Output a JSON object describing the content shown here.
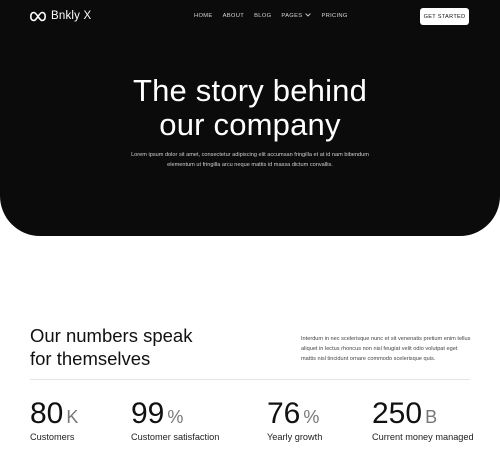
{
  "brand": {
    "name": "Bnkly X"
  },
  "nav": {
    "items": [
      {
        "label": "HOME"
      },
      {
        "label": "ABOUT"
      },
      {
        "label": "BLOG"
      },
      {
        "label": "PAGES"
      },
      {
        "label": "PRICING"
      }
    ],
    "cta_label": "GET STARTED"
  },
  "hero": {
    "title_line1": "The story behind",
    "title_line2": "our company",
    "subtitle": "Lorem ipsum dolor sit amet, consectetur adipiscing elit accumsan fringilla et at id nam bibendum elementum ut fringilla arcu neque mattis id massa dictum convallis."
  },
  "numbers": {
    "title_line1": "Our numbers speak",
    "title_line2": "for themselves",
    "description": "Interdum in nec scelerisque nunc et sit venenatis pretium enim tellus aliquet in lectus rhoncus non nisl feugiat velit odio volutpat eget mattis nisl tincidunt ornare commodo scelerisque quis.",
    "stats": [
      {
        "value": "80",
        "unit": "K",
        "label": "Customers"
      },
      {
        "value": "99",
        "unit": "%",
        "label": "Customer satisfaction"
      },
      {
        "value": "76",
        "unit": "%",
        "label": "Yearly growth"
      },
      {
        "value": "250",
        "unit": "B",
        "label": "Current money managed"
      }
    ]
  },
  "colors": {
    "hero_bg": "#0c0b0b",
    "text_dark": "#111111",
    "text_light": "#ffffff"
  },
  "icons": {
    "logo": "infinity-logo-icon",
    "pages_dropdown": "chevron-down-icon"
  }
}
